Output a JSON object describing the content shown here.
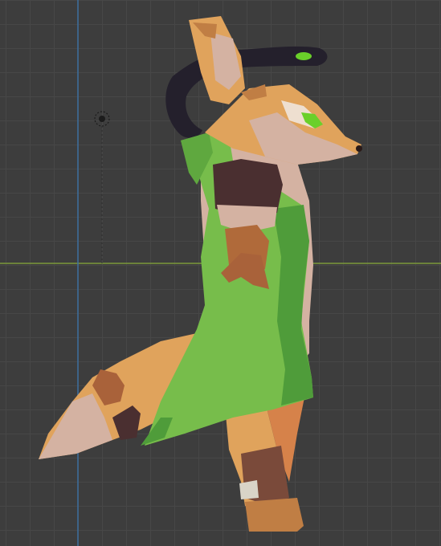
{
  "viewport": {
    "name": "3D viewport",
    "background": "#3d3d3d",
    "grid_line_color": "#474747",
    "x_axis_color": "#7c9a3a",
    "y_axis_color": "#3d6e9e"
  },
  "objects": [
    {
      "name": "light-object",
      "icon": "light-icon"
    },
    {
      "name": "fox-character-model",
      "colors": {
        "fur": "#e0a35c",
        "fur_light": "#d4b2a2",
        "fur_dark": "#a9623a",
        "tunic": "#77bd4b",
        "tunic_dark": "#4f9c3a",
        "boots": "#7a4a3a",
        "bracer": "#4a2f30",
        "scarf": "#24202c",
        "eye": "#6ad02a"
      }
    }
  ]
}
